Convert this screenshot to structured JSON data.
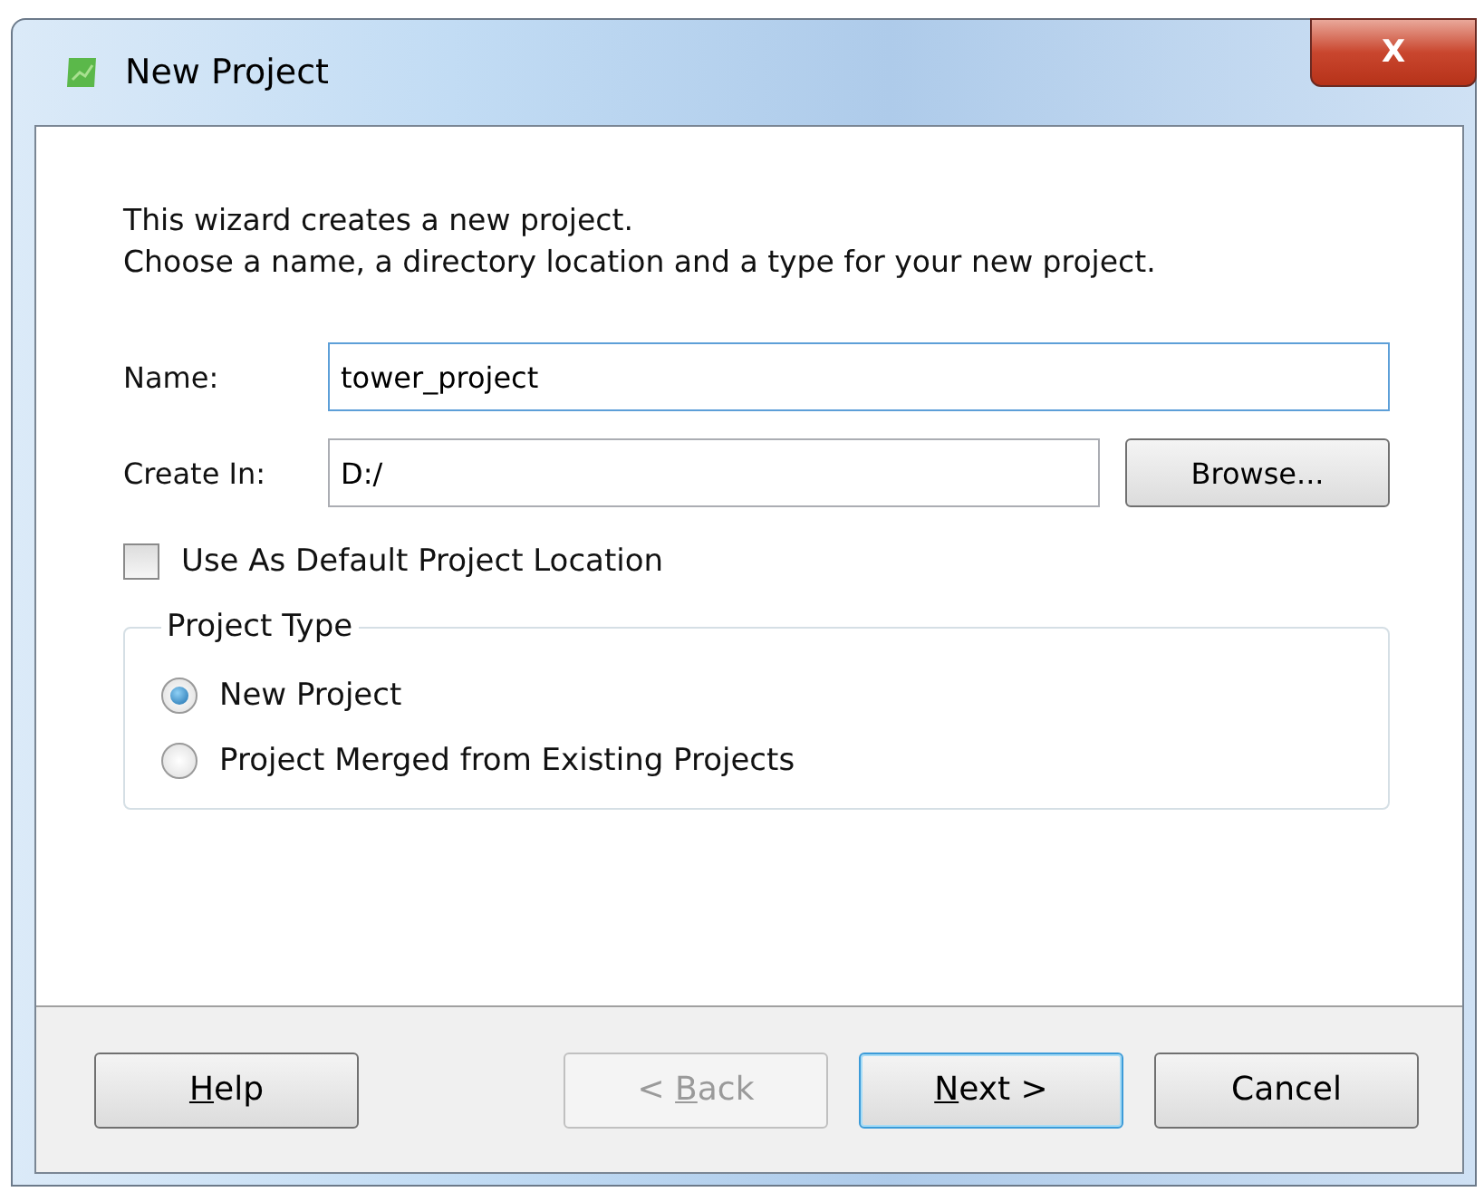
{
  "window": {
    "title": "New Project",
    "close_label": "X"
  },
  "intro": [
    "This wizard creates a new project.",
    "Choose a name, a directory location and a type for your new project."
  ],
  "name_field": {
    "label": "Name:",
    "value": "tower_project"
  },
  "create_in_field": {
    "label": "Create In:",
    "value": "D:/"
  },
  "browse_button": {
    "label": "Browse..."
  },
  "default_location": {
    "label": "Use As Default Project Location",
    "checked": false
  },
  "project_type": {
    "title": "Project Type",
    "options": [
      {
        "label": "New Project",
        "selected": true
      },
      {
        "label": "Project Merged from Existing Projects",
        "selected": false
      }
    ]
  },
  "buttons": [
    {
      "key": "H",
      "post": "elp",
      "disabled": false,
      "default": false
    },
    {
      "pre": "< ",
      "key": "B",
      "post": "ack",
      "disabled": true,
      "default": false
    },
    {
      "key": "N",
      "post": "ext >",
      "disabled": false,
      "default": true
    },
    {
      "pre": "Cancel",
      "disabled": false,
      "default": false
    }
  ]
}
